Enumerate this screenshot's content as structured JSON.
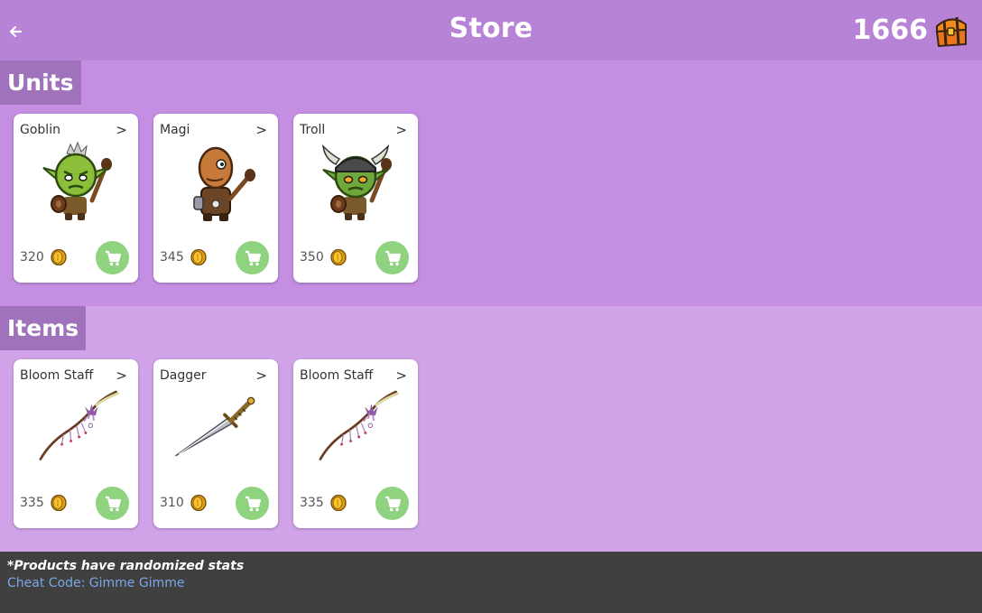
{
  "header": {
    "title": "Store",
    "currency_amount": "1666",
    "currency_icon": "treasure-chest-icon",
    "back_icon": "arrow-left-icon"
  },
  "units": {
    "label": "Units",
    "cards": [
      {
        "name": "Goblin",
        "price": "320",
        "art": "goblin-icon"
      },
      {
        "name": "Magi",
        "price": "345",
        "art": "ogre-magi-icon"
      },
      {
        "name": "Troll",
        "price": "350",
        "art": "troll-icon"
      }
    ]
  },
  "items": {
    "label": "Items",
    "cards": [
      {
        "name": "Bloom Staff",
        "price": "335",
        "art": "bloom-staff-icon"
      },
      {
        "name": "Dagger",
        "price": "310",
        "art": "dagger-icon"
      },
      {
        "name": "Bloom Staff",
        "price": "335",
        "art": "bloom-staff-icon"
      }
    ]
  },
  "footer": {
    "note": "*Products have randomized stats",
    "cheat": "Cheat Code: Gimme Gimme"
  },
  "colors": {
    "header_bg": "#b683d6",
    "units_bg": "#c48ee2",
    "items_bg": "#d1a3e9",
    "section_label_bg": "#9f72bb",
    "buy_button": "#8fd27f",
    "footer_bg": "#404040",
    "cheat_text": "#7aa7e8"
  }
}
